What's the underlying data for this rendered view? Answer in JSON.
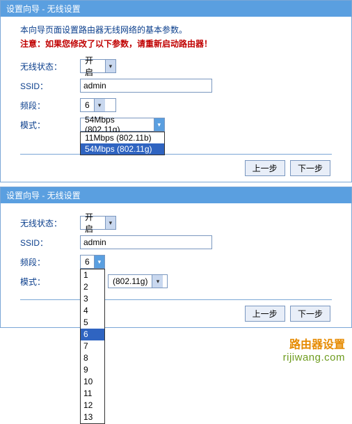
{
  "panel1": {
    "title": "设置向导 - 无线设置",
    "intro": "本向导页面设置路由器无线网络的基本参数。",
    "warning": "注意：如果您修改了以下参数，请重新启动路由器！",
    "labels": {
      "status": "无线状态：",
      "ssid": "SSID：",
      "channel": "频段：",
      "mode": "模式："
    },
    "values": {
      "status": "开启",
      "ssid": "admin",
      "channel": "6",
      "mode": "54Mbps (802.11g)"
    },
    "mode_options": [
      {
        "label": "11Mbps (802.11b)",
        "selected": false
      },
      {
        "label": "54Mbps (802.11g)",
        "selected": true
      }
    ],
    "buttons": {
      "prev": "上一步",
      "next": "下一步"
    }
  },
  "panel2": {
    "title": "设置向导 - 无线设置",
    "labels": {
      "status": "无线状态：",
      "ssid": "SSID：",
      "channel": "频段：",
      "mode": "模式："
    },
    "values": {
      "status": "开启",
      "ssid": "admin",
      "channel": "6",
      "mode_suffix": "(802.11g)"
    },
    "channel_options": [
      "1",
      "2",
      "3",
      "4",
      "5",
      "6",
      "7",
      "8",
      "9",
      "10",
      "11",
      "12",
      "13"
    ],
    "channel_selected_index": 5,
    "buttons": {
      "prev": "上一步",
      "next": "下一步"
    }
  },
  "watermark": {
    "cn": "路由器设置",
    "domain": "rijiwang.com"
  }
}
